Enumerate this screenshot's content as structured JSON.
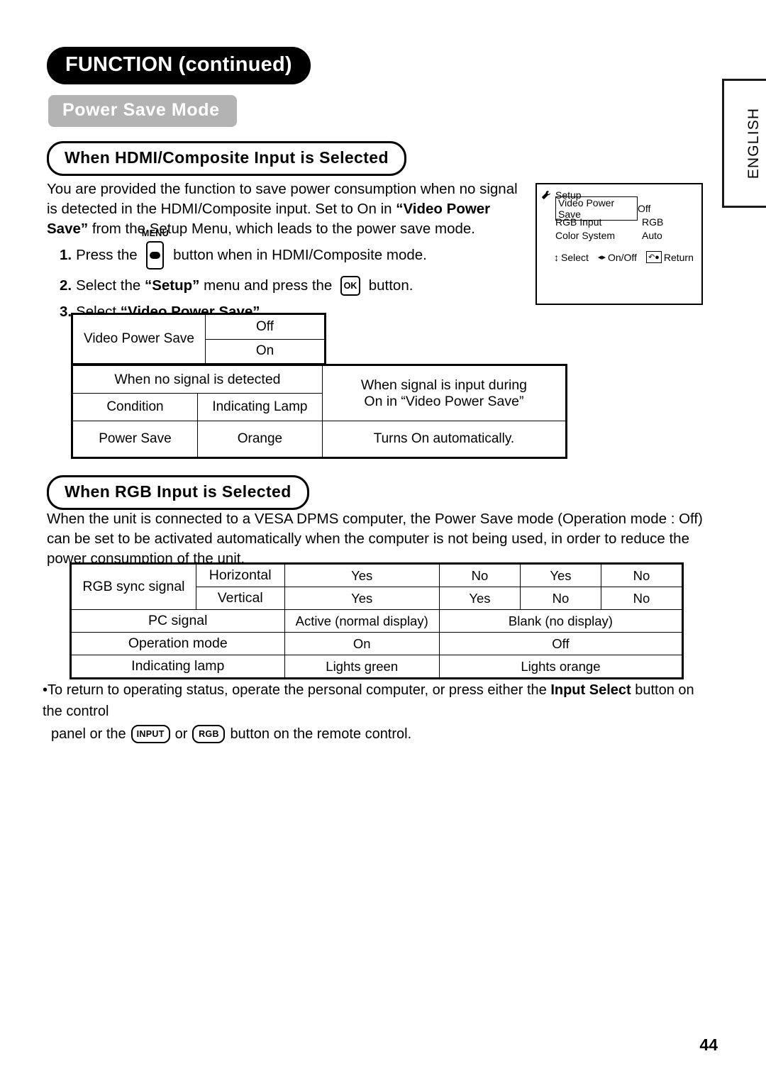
{
  "page": {
    "number": "44",
    "language_tab": "ENGLISH"
  },
  "headings": {
    "chapter": "FUNCTION (continued)",
    "section": "Power Save Mode",
    "sub_hdmi": "When HDMI/Composite Input is Selected",
    "sub_rgb": "When RGB Input is Selected"
  },
  "intro": {
    "part1": "You are provided the function to save power consumption when no signal is detected in the HDMI/Composite input. Set to On in ",
    "bold1": "“Video Power Save”",
    "part2": " from the Setup Menu, which leads to the power save mode."
  },
  "steps": [
    {
      "num": "1.",
      "before": "Press the ",
      "key_label": "MENU",
      "key_name": "menu-button-glyph",
      "after": " button when in HDMI/Composite mode."
    },
    {
      "num": "2.",
      "before": "Select the ",
      "bold": "“Setup”",
      "mid": " menu and press the ",
      "key_label": "OK",
      "after": " button."
    },
    {
      "num": "3.",
      "before": "Select ",
      "bold": "“Video Power Save”",
      "after": "."
    }
  ],
  "osd": {
    "icon": "wrench-icon",
    "title": "Setup",
    "rows": [
      {
        "name": "Video Power Save",
        "value": "Off",
        "selected": true
      },
      {
        "name": "RGB Input",
        "value": "RGB",
        "selected": false
      },
      {
        "name": "Color System",
        "value": "Auto",
        "selected": false
      }
    ],
    "hints": [
      {
        "icon": "up-down-arrow-icon",
        "glyph": "↕",
        "label": "Select"
      },
      {
        "icon": "left-right-arrow-icon",
        "glyph": "◂▸",
        "label": "On/Off"
      },
      {
        "icon": "return-key-icon",
        "glyph": "↶●",
        "label": "Return"
      }
    ]
  },
  "table_vps": {
    "name": "Video Power Save",
    "options": [
      "Off",
      "On"
    ]
  },
  "table_signal": {
    "header_left": "When no signal is detected",
    "header_right_line1": "When signal is input during",
    "header_right_line2": "On in “Video Power Save”",
    "sub_headers": [
      "Condition",
      "Indicating Lamp"
    ],
    "row": [
      "Power Save",
      "Orange",
      "Turns On automatically."
    ]
  },
  "table_rgb": {
    "rgb_sync_label": "RGB sync signal",
    "horizontal_label": "Horizontal",
    "vertical_label": "Vertical",
    "horizontal_values": [
      "Yes",
      "No",
      "Yes",
      "No"
    ],
    "vertical_values": [
      "Yes",
      "Yes",
      "No",
      "No"
    ],
    "rows": [
      {
        "label": "PC signal",
        "values": [
          "Active (normal display)",
          "Blank (no display)"
        ]
      },
      {
        "label": "Operation mode",
        "values": [
          "On",
          "Off"
        ]
      },
      {
        "label": "Indicating lamp",
        "values": [
          "Lights green",
          "Lights orange"
        ]
      }
    ]
  },
  "rgb_para": "When the unit is connected to a VESA DPMS computer, the Power Save mode (Operation mode : Off) can be set to be activated automatically when the computer is not being used, in order to reduce the power consumption of the unit.",
  "note": {
    "bullet": "•",
    "line1_a": "To return to operating status, operate the personal computer, or press either the ",
    "line1_bold": "Input Select",
    "line1_b": " button on the control",
    "line2_a": "panel or the ",
    "key_input": "INPUT",
    "line2_or": "or",
    "key_rgb": "RGB",
    "line2_b": "button on the remote control."
  },
  "colors": {
    "banner_grey": "#b3b3b3",
    "ink": "#000000",
    "paper": "#ffffff"
  }
}
